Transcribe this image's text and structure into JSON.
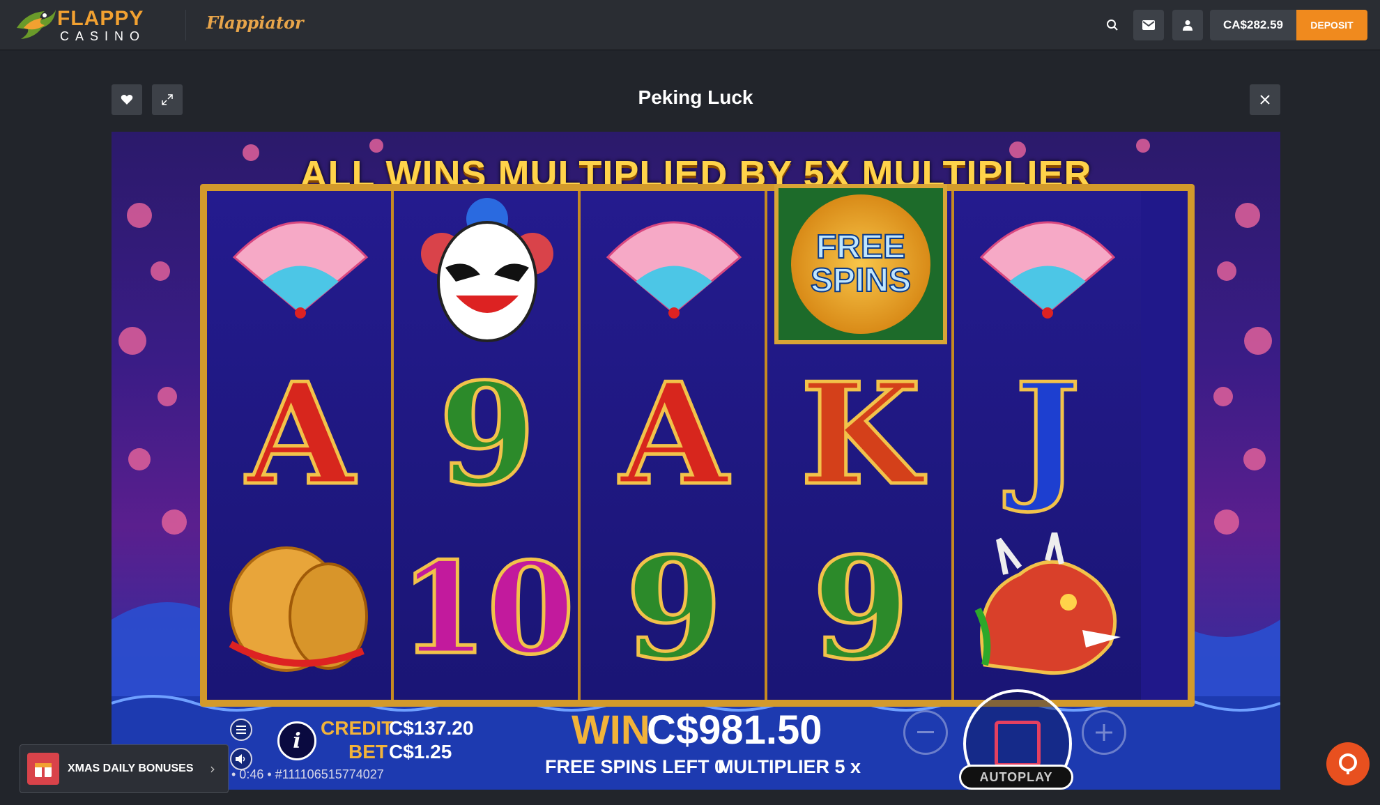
{
  "header": {
    "logo_word1": "FLAPPY",
    "logo_word2": "CASINO",
    "brand_mascot": "Flappiator",
    "balance": "CA$282.59",
    "deposit_label": "DEPOSIT",
    "icons": [
      "search-icon",
      "mail-icon",
      "user-icon"
    ]
  },
  "game_view": {
    "title": "Peking Luck",
    "icons": [
      "heart-icon",
      "expand-icon",
      "close-icon"
    ]
  },
  "game": {
    "banner": "ALL WINS MULTIPLIED BY 5X MULTIPLIER",
    "reels": [
      [
        "fan",
        "A",
        "cymbals"
      ],
      [
        "opera-mask",
        "9",
        "10"
      ],
      [
        "fan",
        "A",
        "9"
      ],
      [
        "free-spins",
        "K",
        "9"
      ],
      [
        "fan",
        "J",
        "dragon"
      ]
    ],
    "free_spins_symbol": {
      "line1": "FREE",
      "line2": "SPINS"
    },
    "credit_label": "CREDIT",
    "credit_value": "C$137.20",
    "bet_label": "BET",
    "bet_value": "C$1.25",
    "meta": "• 0:46 • #111106515774027",
    "win_label": "WIN",
    "win_value": "C$981.50",
    "free_spins_left": "FREE SPINS LEFT 0",
    "multiplier": "MULTIPLIER 5 x",
    "info_label": "i",
    "autoplay_label": "AUTOPLAY"
  },
  "promo": {
    "label": "XMAS DAILY BONUSES",
    "arrow": "›"
  },
  "colors": {
    "accent": "#f08a1e",
    "brand_orange": "#f2a131",
    "win_gold": "#f2b33a",
    "topbar": "#2a2d33",
    "chat": "#e8501f"
  }
}
